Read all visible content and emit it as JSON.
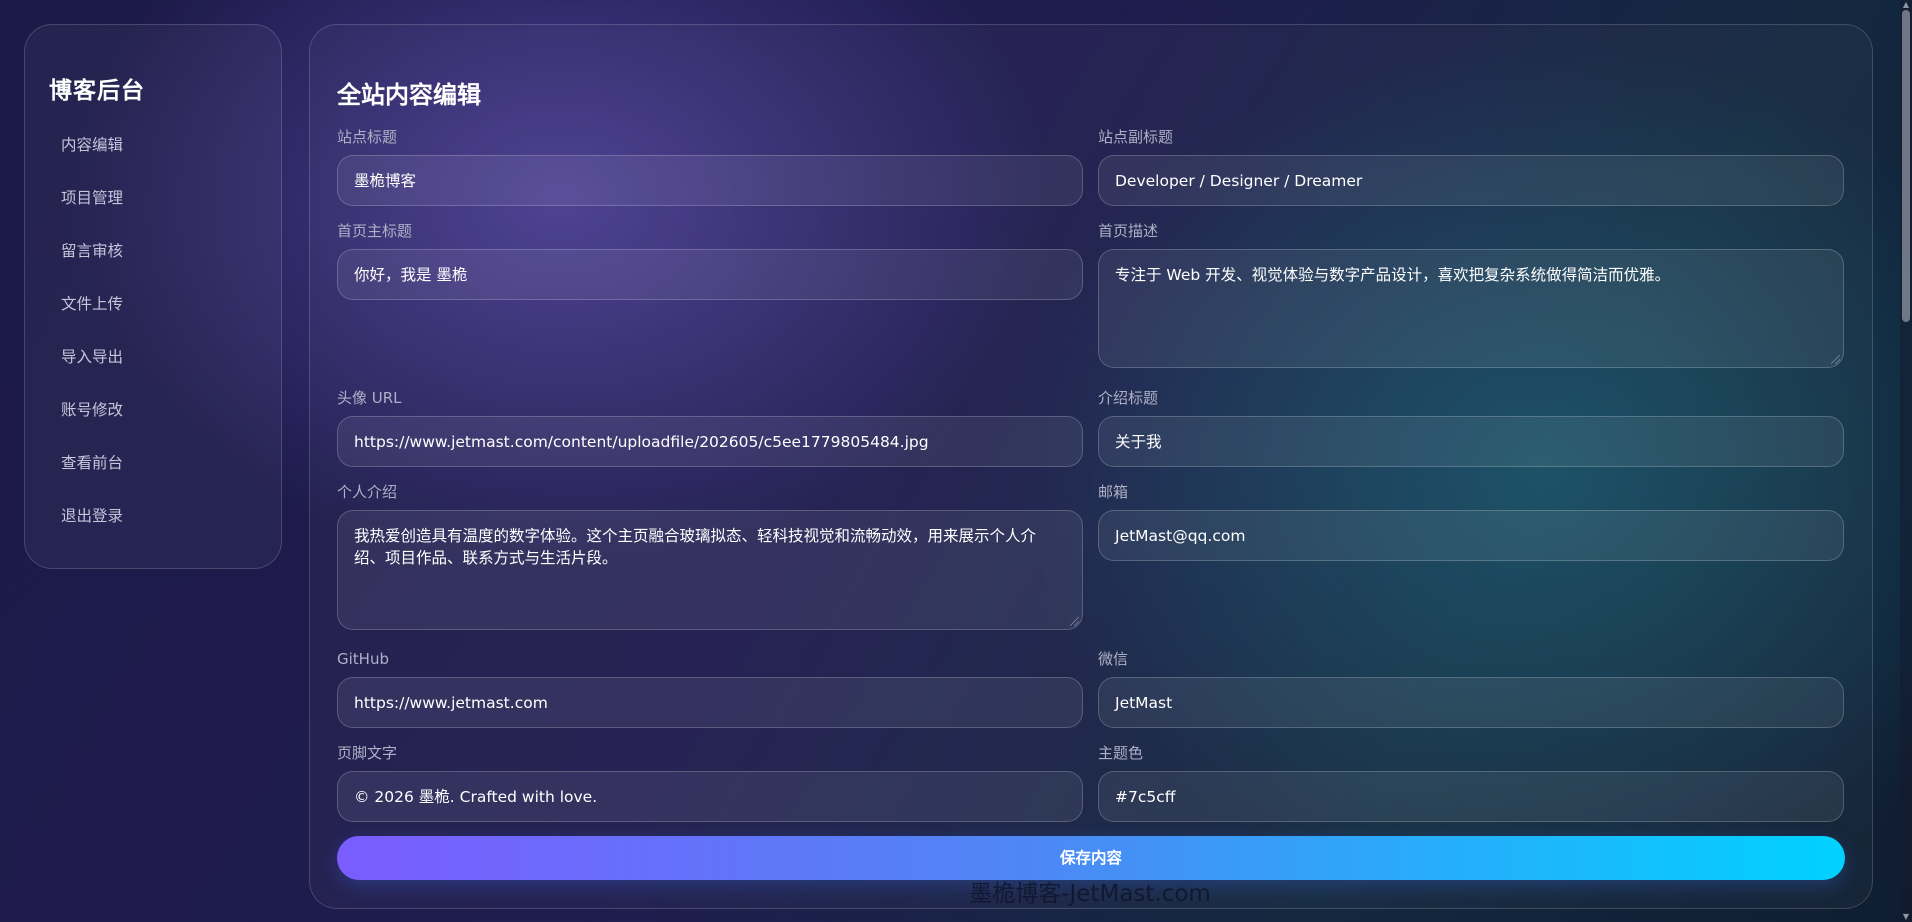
{
  "sidebar": {
    "title": "博客后台",
    "items": [
      {
        "label": "内容编辑"
      },
      {
        "label": "项目管理"
      },
      {
        "label": "留言审核"
      },
      {
        "label": "文件上传"
      },
      {
        "label": "导入导出"
      },
      {
        "label": "账号修改"
      },
      {
        "label": "查看前台"
      },
      {
        "label": "退出登录"
      }
    ]
  },
  "main": {
    "title": "全站内容编辑",
    "fields": {
      "site_title": {
        "label": "站点标题",
        "value": "墨桅博客"
      },
      "site_subtitle": {
        "label": "站点副标题",
        "value": "Developer / Designer / Dreamer"
      },
      "home_title": {
        "label": "首页主标题",
        "value": "你好，我是 墨桅"
      },
      "home_desc": {
        "label": "首页描述",
        "value": "专注于 Web 开发、视觉体验与数字产品设计，喜欢把复杂系统做得简洁而优雅。"
      },
      "avatar_url": {
        "label": "头像 URL",
        "value": "https://www.jetmast.com/content/uploadfile/202605/c5ee1779805484.jpg"
      },
      "intro_title": {
        "label": "介绍标题",
        "value": "关于我"
      },
      "bio": {
        "label": "个人介绍",
        "value": "我热爱创造具有温度的数字体验。这个主页融合玻璃拟态、轻科技视觉和流畅动效，用来展示个人介绍、项目作品、联系方式与生活片段。"
      },
      "email": {
        "label": "邮箱",
        "value": "JetMast@qq.com"
      },
      "github": {
        "label": "GitHub",
        "value": "https://www.jetmast.com"
      },
      "wechat": {
        "label": "微信",
        "value": "JetMast"
      },
      "footer": {
        "label": "页脚文字",
        "value": "© 2026 墨桅. Crafted with love."
      },
      "theme_color": {
        "label": "主题色",
        "value": "#7c5cff"
      }
    },
    "save_label": "保存内容"
  },
  "watermark": "墨桅博客-JetMast.com",
  "colors": {
    "accent_start": "#7b5cff",
    "accent_end": "#00d2ff"
  }
}
